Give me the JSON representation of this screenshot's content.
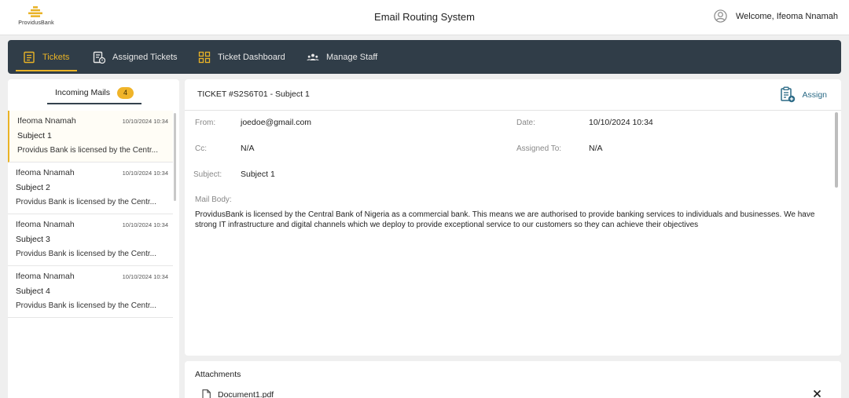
{
  "brand": {
    "logo_text": "ProvidusBank",
    "accent_color": "#e9b326"
  },
  "header": {
    "title": "Email Routing System",
    "welcome_text": "Welcome, Ifeoma Nnamah"
  },
  "nav": {
    "items": [
      {
        "label": "Tickets",
        "icon": "ticket-list-icon",
        "active": true
      },
      {
        "label": "Assigned Tickets",
        "icon": "assigned-ticket-icon",
        "active": false
      },
      {
        "label": "Ticket Dashboard",
        "icon": "dashboard-grid-icon",
        "active": false
      },
      {
        "label": "Manage Staff",
        "icon": "staff-group-icon",
        "active": false
      }
    ]
  },
  "inbox": {
    "tab_label": "Incoming Mails",
    "count": "4",
    "mails": [
      {
        "sender": "Ifeoma Nnamah",
        "date": "10/10/2024 10:34",
        "subject": "Subject 1",
        "preview": "Providus Bank is licensed by the Centr...",
        "selected": true
      },
      {
        "sender": "Ifeoma Nnamah",
        "date": "10/10/2024 10:34",
        "subject": "Subject 2",
        "preview": "Providus Bank is licensed by the Centr...",
        "selected": false
      },
      {
        "sender": "Ifeoma Nnamah",
        "date": "10/10/2024 10:34",
        "subject": "Subject 3",
        "preview": "Providus Bank is licensed by the Centr...",
        "selected": false
      },
      {
        "sender": "Ifeoma Nnamah",
        "date": "10/10/2024 10:34",
        "subject": "Subject 4",
        "preview": "Providus Bank is licensed by the Centr...",
        "selected": false
      }
    ]
  },
  "ticket": {
    "title": "TICKET #S2S6T01 - Subject 1",
    "assign_label": "Assign",
    "from_label": "From:",
    "from_value": "joedoe@gmail.com",
    "date_label": "Date:",
    "date_value": "10/10/2024 10:34",
    "cc_label": "Cc:",
    "cc_value": "N/A",
    "assigned_label": "Assigned To:",
    "assigned_value": "N/A",
    "subject_label": "Subject:",
    "subject_value": "Subject 1",
    "body_label": "Mail Body:",
    "body_text": "ProvidusBank is licensed by the Central Bank of Nigeria as a commercial bank. This means we are authorised to provide banking services to individuals and businesses. We have strong IT infrastructure and digital channels which we deploy to provide exceptional service to our customers so they can achieve their objectives"
  },
  "attachments": {
    "title": "Attachments",
    "files": [
      {
        "name": "Document1.pdf"
      }
    ]
  }
}
